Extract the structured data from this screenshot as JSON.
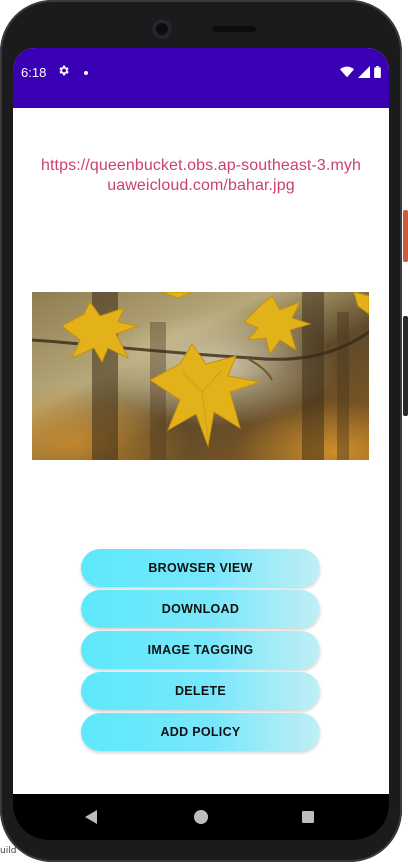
{
  "status_bar": {
    "time": "6:18",
    "icons": [
      "gear-icon",
      "notification-dot-icon",
      "wifi-icon",
      "cell-signal-icon",
      "battery-icon"
    ],
    "background_color": "#3a00b4"
  },
  "content": {
    "url": "https://queenbucket.obs.ap-southeast-3.myhuaweicloud.com/bahar.jpg",
    "url_color": "#cc3f73"
  },
  "buttons": [
    {
      "label": "BROWSER VIEW"
    },
    {
      "label": "DOWNLOAD"
    },
    {
      "label": "IMAGE TAGGING"
    },
    {
      "label": "DELETE"
    },
    {
      "label": "ADD POLICY"
    }
  ],
  "nav_bar": {
    "icons": [
      "back-icon",
      "home-icon",
      "recents-icon"
    ]
  },
  "background_fragment": {
    "text": "uild"
  }
}
